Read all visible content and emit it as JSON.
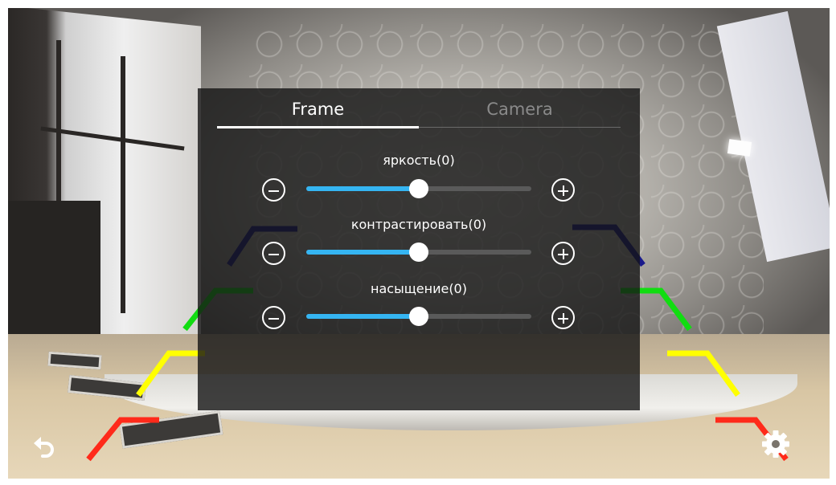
{
  "tabs": [
    {
      "label": "Frame",
      "active": true
    },
    {
      "label": "Camera",
      "active": false
    }
  ],
  "sliders": [
    {
      "label": "яркость(0)",
      "value": 0,
      "fraction": 0.5
    },
    {
      "label": "контрастировать(0)",
      "value": 0,
      "fraction": 0.5
    },
    {
      "label": "насыщение(0)",
      "value": 0,
      "fraction": 0.5
    }
  ],
  "controls": {
    "back_icon": "back-arrow-icon",
    "settings_icon": "gear-icon"
  },
  "colors": {
    "slider_fill": "#35b5f2",
    "slider_track": "#5a5a5a",
    "guide_red": "#ff2a1a",
    "guide_yellow": "#ffff00",
    "guide_green": "#11dd11",
    "guide_blue": "#2020a0"
  }
}
